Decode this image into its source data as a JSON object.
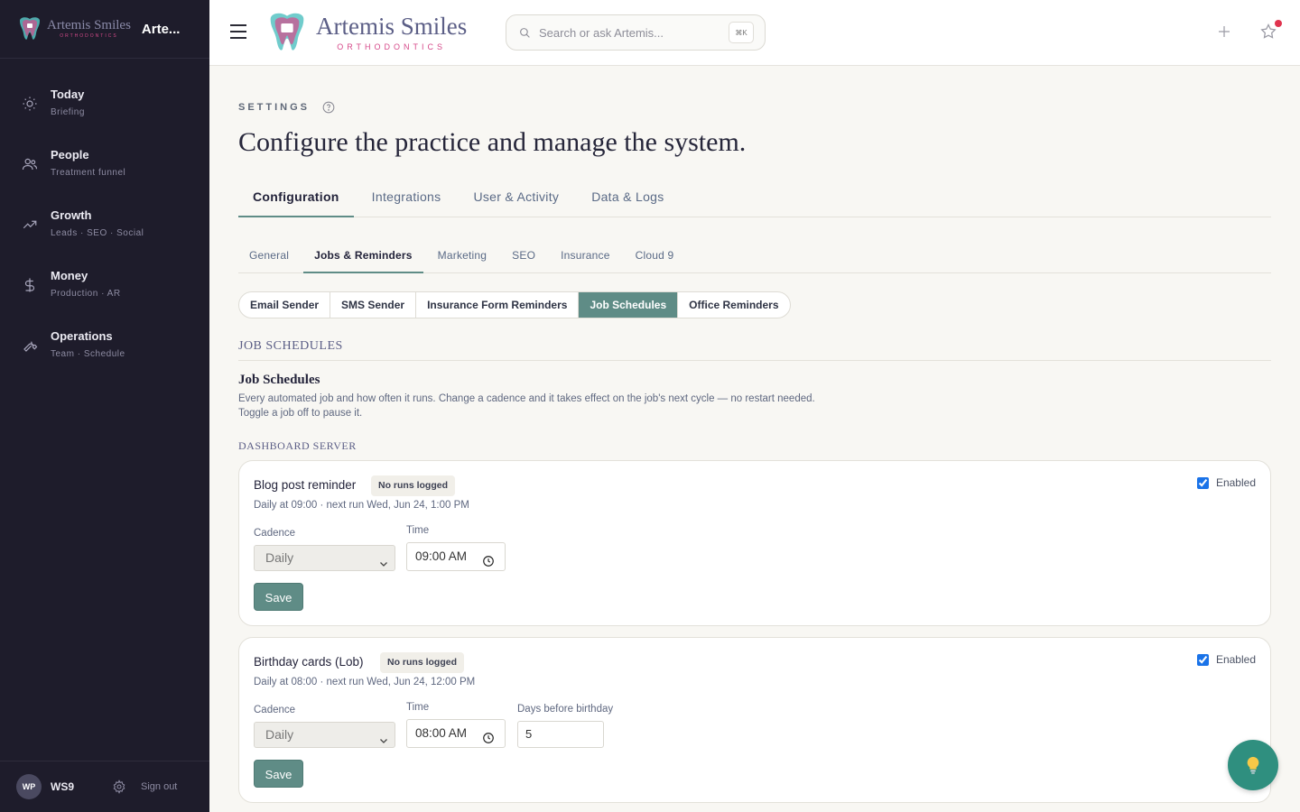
{
  "colors": {
    "sidebar_bg": "#1e1c2b",
    "accent": "#5f8c86",
    "brand_pink": "#d64a8a",
    "brand_text": "#5b5e86",
    "fab": "#2f8f7f"
  },
  "sidebar": {
    "logo": {
      "name": "Artemis Smiles",
      "sub": "ORTHODONTICS"
    },
    "app_title": "Arte...",
    "items": [
      {
        "label": "Today",
        "sub": "Briefing",
        "icon": "sun-icon"
      },
      {
        "label": "People",
        "sub": "Treatment funnel",
        "icon": "users-icon"
      },
      {
        "label": "Growth",
        "sub": "Leads · SEO · Social",
        "icon": "trending-up-icon"
      },
      {
        "label": "Money",
        "sub": "Production · AR",
        "icon": "dollar-icon"
      },
      {
        "label": "Operations",
        "sub": "Team · Schedule",
        "icon": "wrench-icon"
      }
    ],
    "footer": {
      "avatar": "WP",
      "user": "WS9",
      "signout": "Sign out"
    }
  },
  "topbar": {
    "logo": {
      "name": "Artemis Smiles",
      "sub": "ORTHODONTICS"
    },
    "search": {
      "placeholder": "Search or ask Artemis...",
      "shortcut": "⌘K"
    }
  },
  "page": {
    "eyebrow": "SETTINGS",
    "title": "Configure the practice and manage the system.",
    "tabs": [
      "Configuration",
      "Integrations",
      "User & Activity",
      "Data & Logs"
    ],
    "active_tab": "Configuration",
    "subtabs": [
      "General",
      "Jobs & Reminders",
      "Marketing",
      "SEO",
      "Insurance",
      "Cloud 9"
    ],
    "active_subtab": "Jobs & Reminders",
    "pills": [
      "Email Sender",
      "SMS Sender",
      "Insurance Form Reminders",
      "Job Schedules",
      "Office Reminders"
    ],
    "active_pill": "Job Schedules",
    "section_head": "JOB SCHEDULES",
    "section_title": "Job Schedules",
    "section_desc": "Every automated job and how often it runs. Change a cadence and it takes effect on the job's next cycle — no restart needed. Toggle a job off to pause it.",
    "group_label": "DASHBOARD SERVER"
  },
  "jobs": [
    {
      "name": "Blog post reminder",
      "badge": "No runs logged",
      "meta": "Daily at 09:00 · next run Wed, Jun 24, 1:00 PM",
      "enabled": true,
      "enabled_label": "Enabled",
      "cadence_label": "Cadence",
      "cadence": "Daily",
      "time_label": "Time",
      "time": "09:00 AM",
      "save": "Save"
    },
    {
      "name": "Birthday cards (Lob)",
      "badge": "No runs logged",
      "meta": "Daily at 08:00 · next run Wed, Jun 24, 12:00 PM",
      "enabled": true,
      "enabled_label": "Enabled",
      "cadence_label": "Cadence",
      "cadence": "Daily",
      "time_label": "Time",
      "time": "08:00 AM",
      "extra_label": "Days before birthday",
      "extra_value": "5",
      "save": "Save"
    }
  ],
  "fab": {
    "icon": "lightbulb-icon"
  }
}
